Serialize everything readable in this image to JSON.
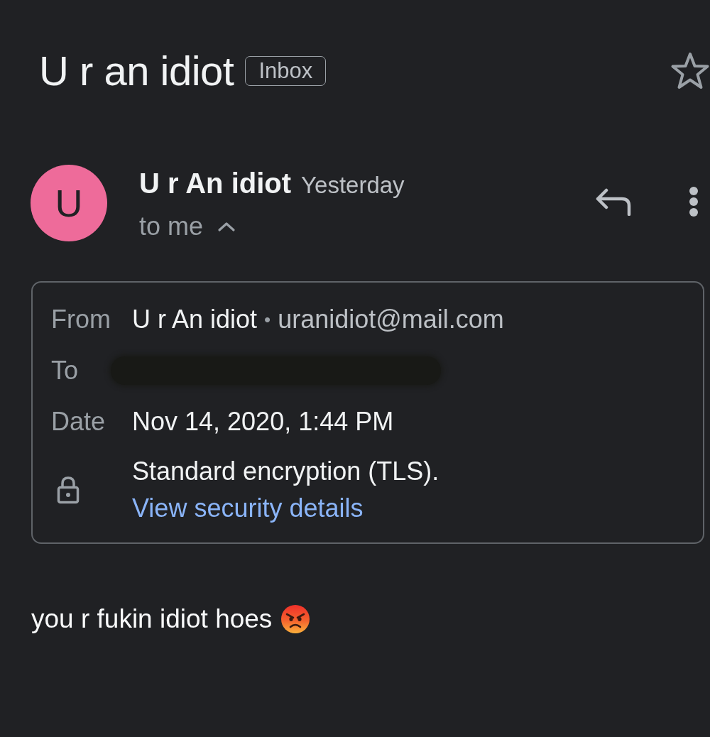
{
  "header": {
    "subject": "U r an idiot",
    "label": "Inbox",
    "starred": false
  },
  "message": {
    "avatar_letter": "U",
    "sender": "U r An idiot",
    "time": "Yesterday",
    "recipient_line": "to me",
    "details_expanded": true
  },
  "details": {
    "rows": [
      {
        "kind": "sender",
        "label": "From",
        "name": "U r An idiot",
        "separator": "•",
        "email": "uranidiot@mail.com"
      },
      {
        "kind": "redacted",
        "label": "To"
      },
      {
        "kind": "text",
        "label": "Date",
        "value": "Nov 14, 2020, 1:44 PM"
      },
      {
        "kind": "security",
        "text": "Standard encryption (TLS).",
        "link": "View security details"
      }
    ]
  },
  "body": {
    "text": "you r fukin idiot hoes"
  }
}
